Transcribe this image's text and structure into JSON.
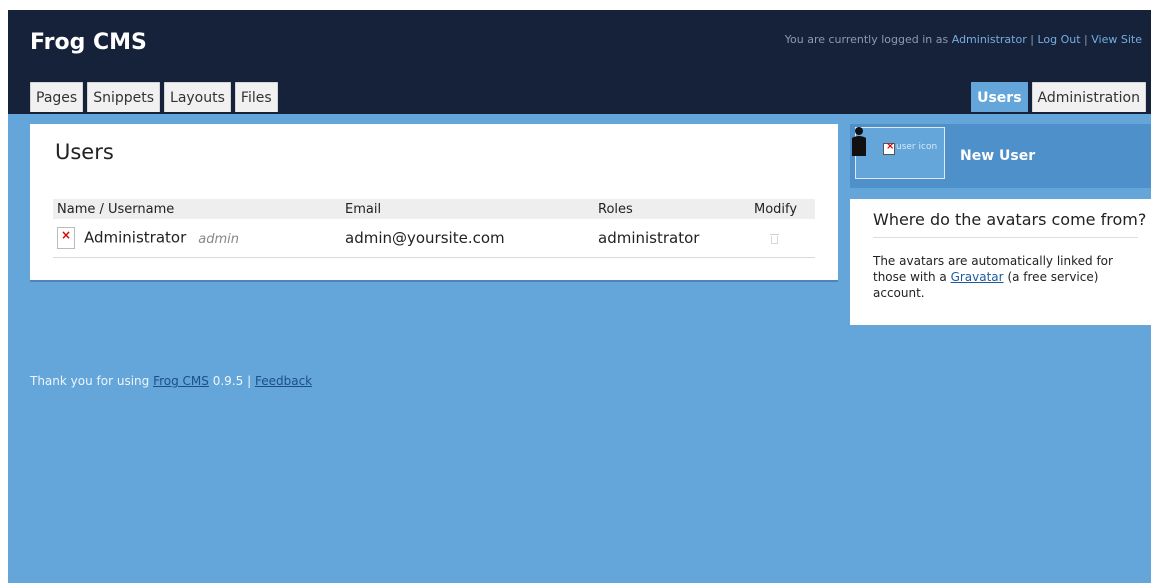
{
  "header": {
    "logo": "Frog CMS",
    "login_prefix": "You are currently logged in as",
    "user_link": "Administrator",
    "separator": "|",
    "logout": "Log Out",
    "view_site": "View Site"
  },
  "tabs_left": [
    "Pages",
    "Snippets",
    "Layouts",
    "Files"
  ],
  "tabs_right": [
    {
      "label": "Users",
      "active": true
    },
    {
      "label": "Administration",
      "active": false
    }
  ],
  "main": {
    "title": "Users",
    "columns": [
      "Name / Username",
      "Email",
      "Roles",
      "Modify"
    ],
    "rows": [
      {
        "name": "Administrator",
        "username": "admin",
        "email": "admin@yoursite.com",
        "roles": "administrator",
        "modify_icon": "trash-icon"
      }
    ]
  },
  "sidebar": {
    "new_user_icon_alt": "user icon",
    "new_user_label": "New User",
    "info_title": "Where do the avatars come from?",
    "info_text_before": "The avatars are automatically linked for those with a",
    "info_link": "Gravatar",
    "info_text_after": "(a free service) account."
  },
  "footer": {
    "prefix": "Thank you for using",
    "cms_link": "Frog CMS",
    "version": "0.9.5",
    "separator": "|",
    "feedback": "Feedback"
  },
  "colors": {
    "header_bg": "#15223a",
    "body_bg": "#64a6da",
    "new_user_bg": "#4e90c9",
    "link": "#76aee0"
  }
}
